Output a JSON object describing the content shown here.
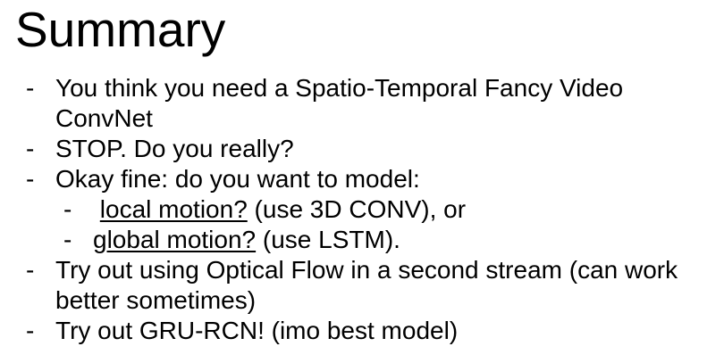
{
  "slide": {
    "title": "Summary",
    "bullets": [
      {
        "dash": "-",
        "line1": "You think you need a Spatio-Temporal Fancy Video",
        "line2": "ConvNet"
      },
      {
        "dash": "-",
        "line1": "STOP. Do you really?"
      },
      {
        "dash": "-",
        "line1": "Okay fine: do you want to model:"
      },
      {
        "dash": "-",
        "link": "local motion?",
        "rest": " (use 3D CONV), or"
      },
      {
        "dash": "-",
        "link": "global motion?",
        "rest": " (use LSTM)."
      },
      {
        "dash": "-",
        "line1": "Try out using Optical Flow in a second stream (can work",
        "line2": "better sometimes)"
      },
      {
        "dash": "-",
        "line1": "Try out GRU-RCN! (imo best model)"
      }
    ]
  }
}
